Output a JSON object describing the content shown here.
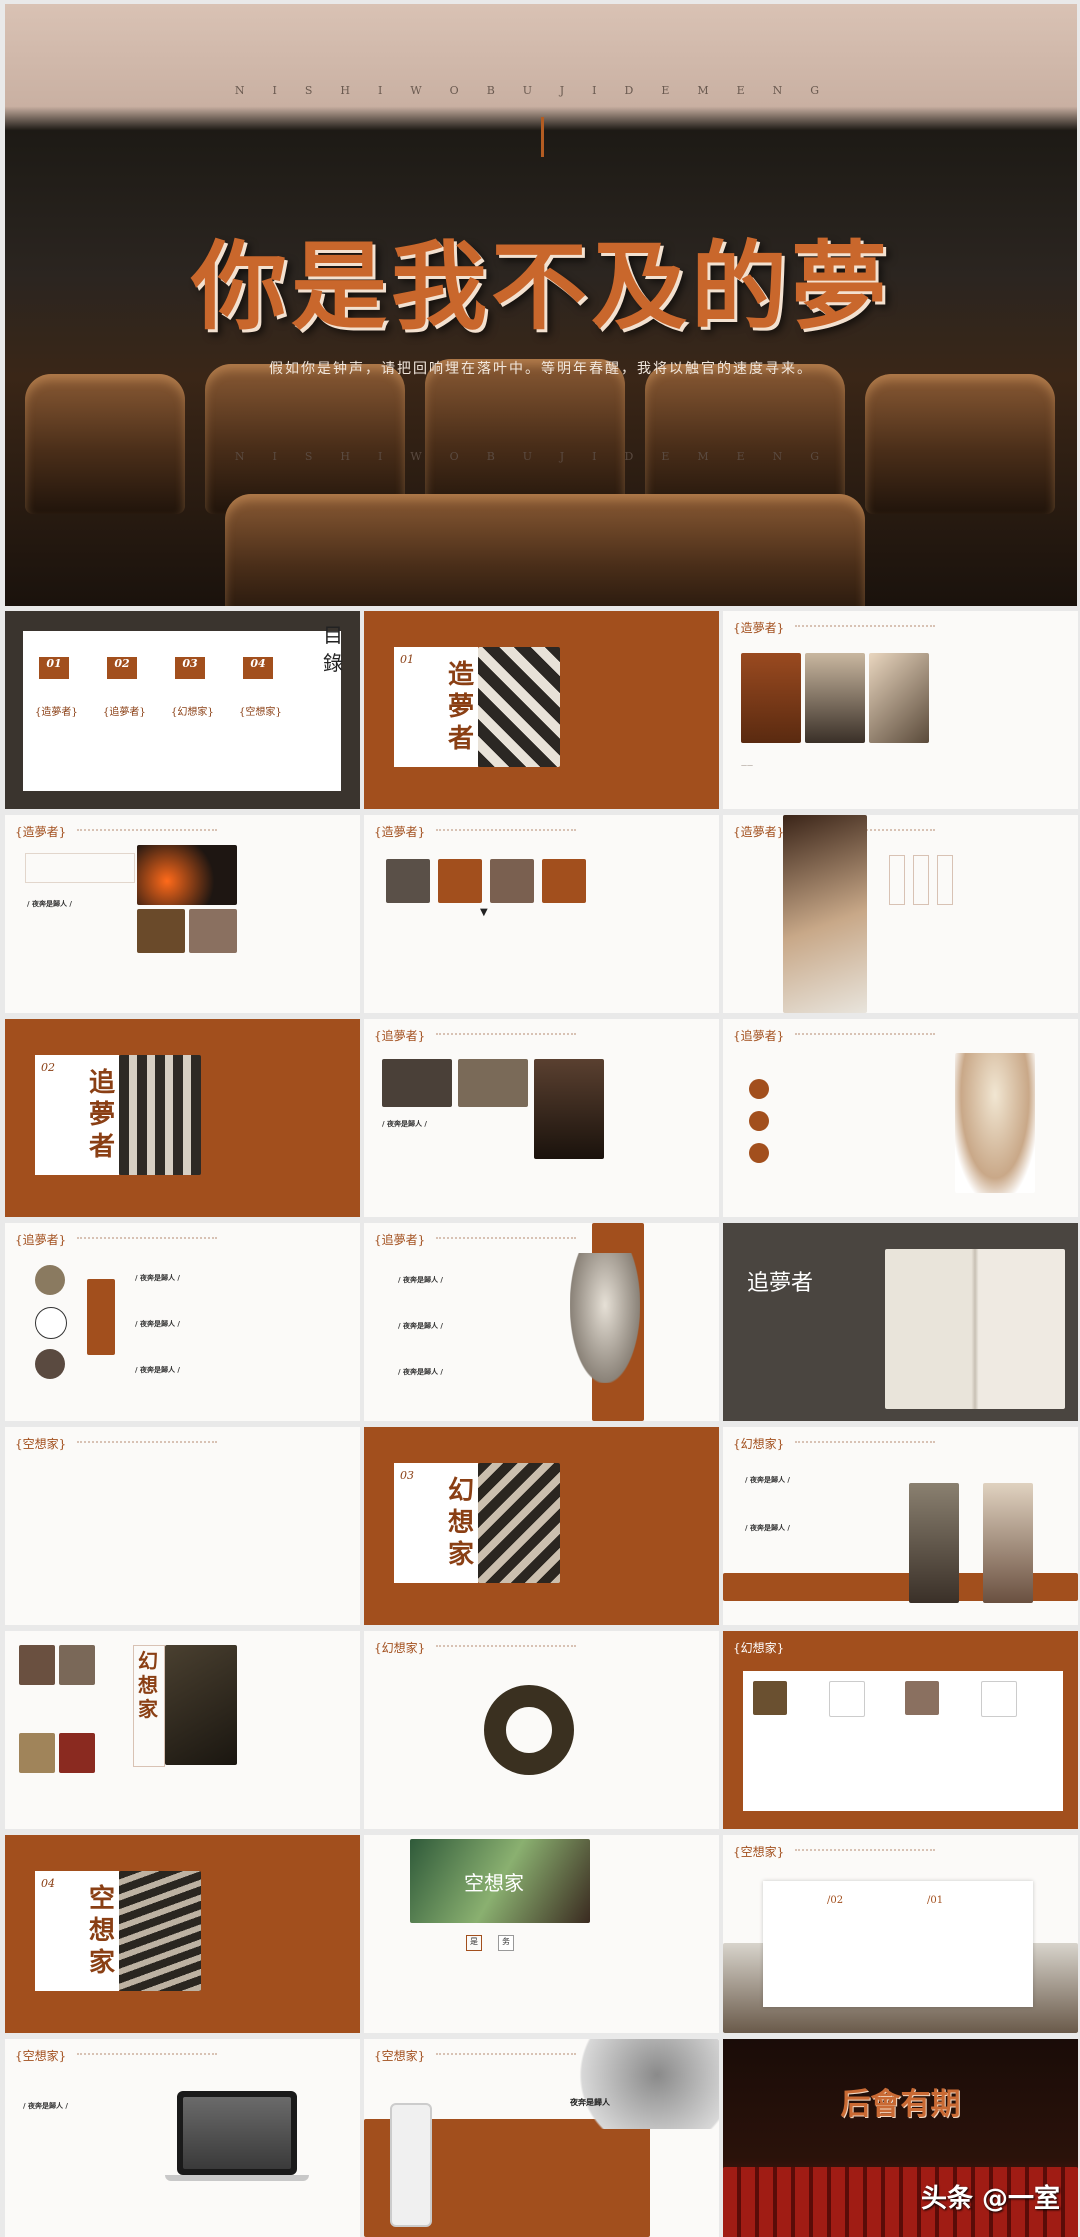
{
  "hero": {
    "spaced_top": "NISHIWOBUJIDEMENG",
    "title": "你是我不及的夢",
    "subtitle": "假如你是钟声，请把回响埋在落叶中。等明年春醒，我将以触官的速度寻来。",
    "spaced_bottom": "NISHIWOBUJIDEMENG"
  },
  "toc": {
    "label_a": "目",
    "label_b": "錄",
    "items": [
      {
        "num": "01",
        "name": "{造夢者}"
      },
      {
        "num": "02",
        "name": "{追夢者}"
      },
      {
        "num": "03",
        "name": "{幻想家}"
      },
      {
        "num": "04",
        "name": "{空想家}"
      }
    ]
  },
  "sections": {
    "s1": {
      "num": "01",
      "title": "造夢者"
    },
    "s2": {
      "num": "02",
      "title": "追夢者"
    },
    "s3": {
      "num": "03",
      "title": "幻想家"
    },
    "s4": {
      "num": "04",
      "title": "空想家"
    }
  },
  "tags": {
    "zaomeng": "{造夢者}",
    "zhuimeng": "{追夢者}",
    "huanxiang": "{幻想家}",
    "kongxiang": "{空想家}"
  },
  "labels": {
    "who": "/ 夜奔是歸人 /",
    "who2": "夜奔是歸人",
    "zhuimengzhe": "追夢者",
    "huanxiangjia": "幻想家",
    "kongxiangjia": "空想家",
    "houhui": "后會有期",
    "shi": "是",
    "wu": "务",
    "n01": "/01",
    "n02": "/02"
  },
  "watermark": "头条 @一室"
}
